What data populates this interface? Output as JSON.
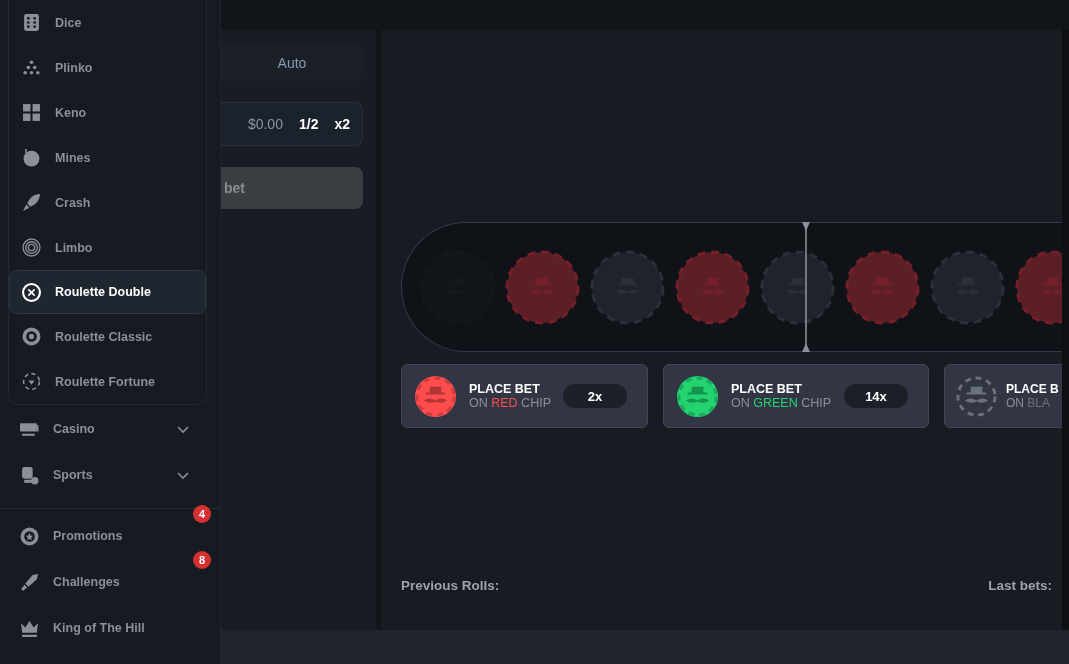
{
  "sidebar": {
    "games": [
      {
        "label": "Dice",
        "selected": false
      },
      {
        "label": "Plinko",
        "selected": false
      },
      {
        "label": "Keno",
        "selected": false
      },
      {
        "label": "Mines",
        "selected": false
      },
      {
        "label": "Crash",
        "selected": false
      },
      {
        "label": "Limbo",
        "selected": false
      },
      {
        "label": "Roulette Double",
        "selected": true
      },
      {
        "label": "Roulette Classic",
        "selected": false
      },
      {
        "label": "Roulette Fortune",
        "selected": false
      }
    ],
    "sections": [
      {
        "label": "Casino",
        "expanded": false
      },
      {
        "label": "Sports",
        "expanded": false
      }
    ],
    "links": [
      {
        "label": "Promotions",
        "badge": "4"
      },
      {
        "label": "Challenges",
        "badge": "8"
      },
      {
        "label": "King of The Hill"
      }
    ]
  },
  "bet_panel": {
    "tabs": [
      {
        "label": "Auto",
        "selected": false
      }
    ],
    "amount": "$0.00",
    "half": "1/2",
    "double": "x2",
    "submit": "bet"
  },
  "strip": {
    "chips": [
      {
        "kind": "black",
        "faded": true
      },
      {
        "kind": "red",
        "faded": false
      },
      {
        "kind": "black",
        "faded": false
      },
      {
        "kind": "red",
        "faded": false
      },
      {
        "kind": "black",
        "faded": false
      },
      {
        "kind": "red",
        "faded": false
      },
      {
        "kind": "black",
        "faded": false
      },
      {
        "kind": "red",
        "faded": false
      }
    ]
  },
  "bet_cards": [
    {
      "title": "PLACE BET",
      "prefix": "ON",
      "color_word": "RED",
      "suffix": "CHIP",
      "color": "#ff4c4c",
      "multiplier": "2x",
      "kind": "solid"
    },
    {
      "title": "PLACE BET",
      "prefix": "ON",
      "color_word": "GREEN",
      "suffix": "CHIP",
      "color": "#22d36f",
      "multiplier": "14x",
      "kind": "solid"
    },
    {
      "title": "PLACE B",
      "prefix": "ON",
      "color_word": "BLA",
      "color": "#6a707c",
      "kind": "outline"
    }
  ],
  "previous_rolls": "Previous Rolls:",
  "last_bets": "Last bets:"
}
